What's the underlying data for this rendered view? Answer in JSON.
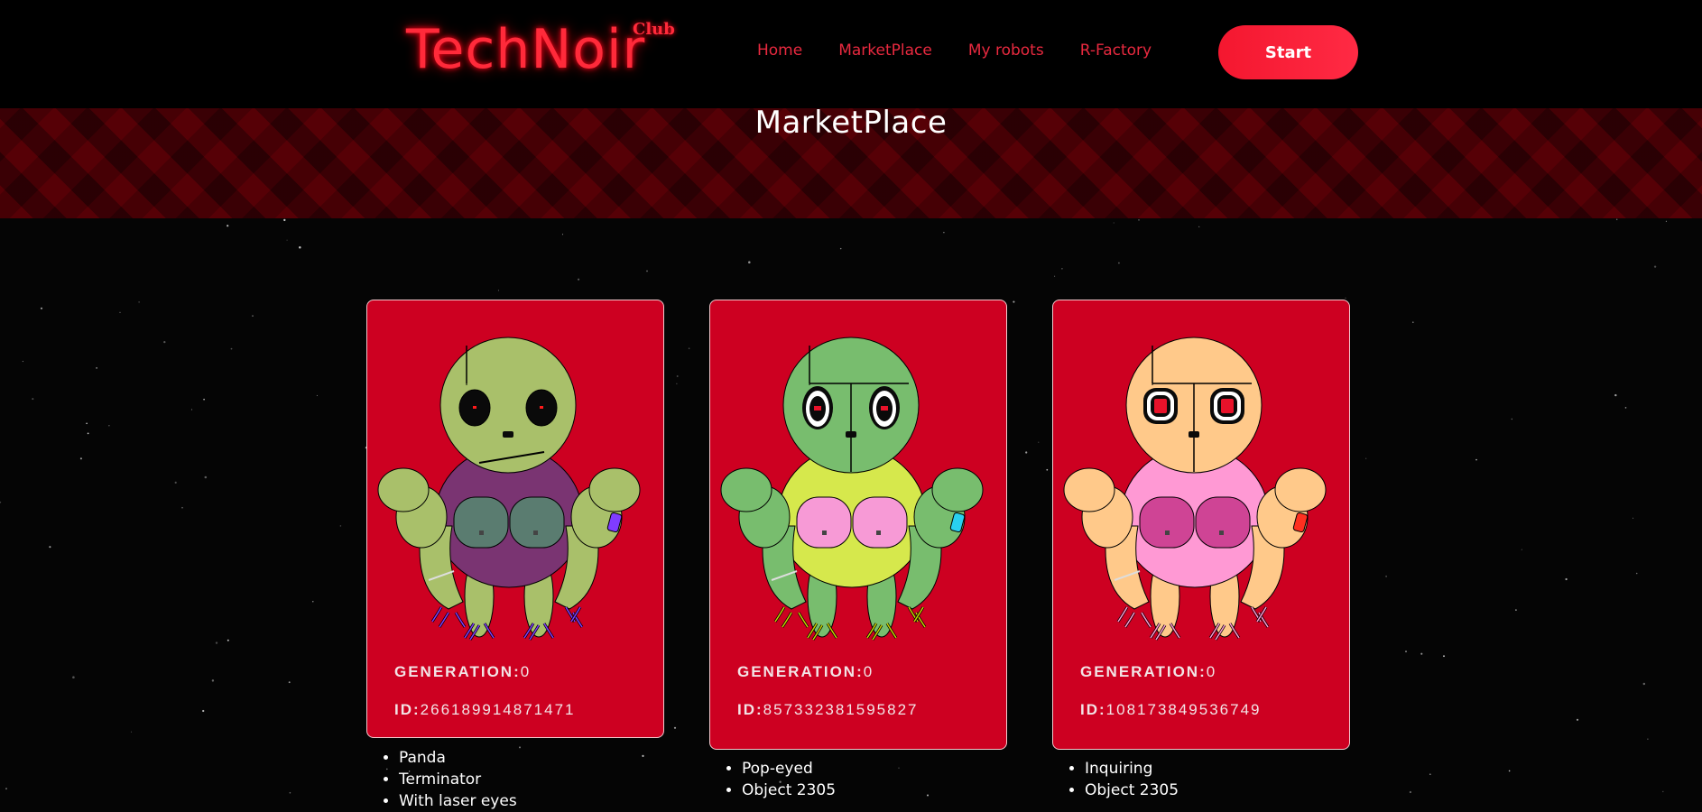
{
  "brand": {
    "name": "TechNoir",
    "superscript": "Club",
    "color": "#ff2a3a"
  },
  "nav": {
    "items": [
      {
        "label": "Home"
      },
      {
        "label": "MarketPlace"
      },
      {
        "label": "My robots"
      },
      {
        "label": "R-Factory"
      }
    ],
    "start_label": "Start"
  },
  "page": {
    "title": "MarketPlace"
  },
  "cards": [
    {
      "generation_label": "GENERATION:",
      "generation": "0",
      "id_label": "ID:",
      "id": "266189914871471",
      "traits": [
        "Panda",
        "Terminator",
        "With laser eyes"
      ],
      "colors": {
        "head": "#a9c06a",
        "body": "#7a3472",
        "chest": "#5a7c70",
        "limbs": "#a9c06a",
        "accent": "#7f3cff",
        "claws": "#7f3cff"
      }
    },
    {
      "generation_label": "GENERATION:",
      "generation": "0",
      "id_label": "ID:",
      "id": "857332381595827",
      "traits": [
        "Pop-eyed",
        "Object 2305"
      ],
      "colors": {
        "head": "#78bd6e",
        "body": "#d6e84c",
        "chest": "#f79ad6",
        "limbs": "#78bd6e",
        "accent": "#29d0f0",
        "claws": "#c5d400"
      }
    },
    {
      "generation_label": "GENERATION:",
      "generation": "0",
      "id_label": "ID:",
      "id": "108173849536749",
      "traits": [
        "Inquiring",
        "Object 2305"
      ],
      "colors": {
        "head": "#ffc98a",
        "body": "#ff99d4",
        "chest": "#cf4495",
        "limbs": "#ffc98a",
        "accent": "#ff3020",
        "claws": "#ff99d4"
      }
    }
  ]
}
